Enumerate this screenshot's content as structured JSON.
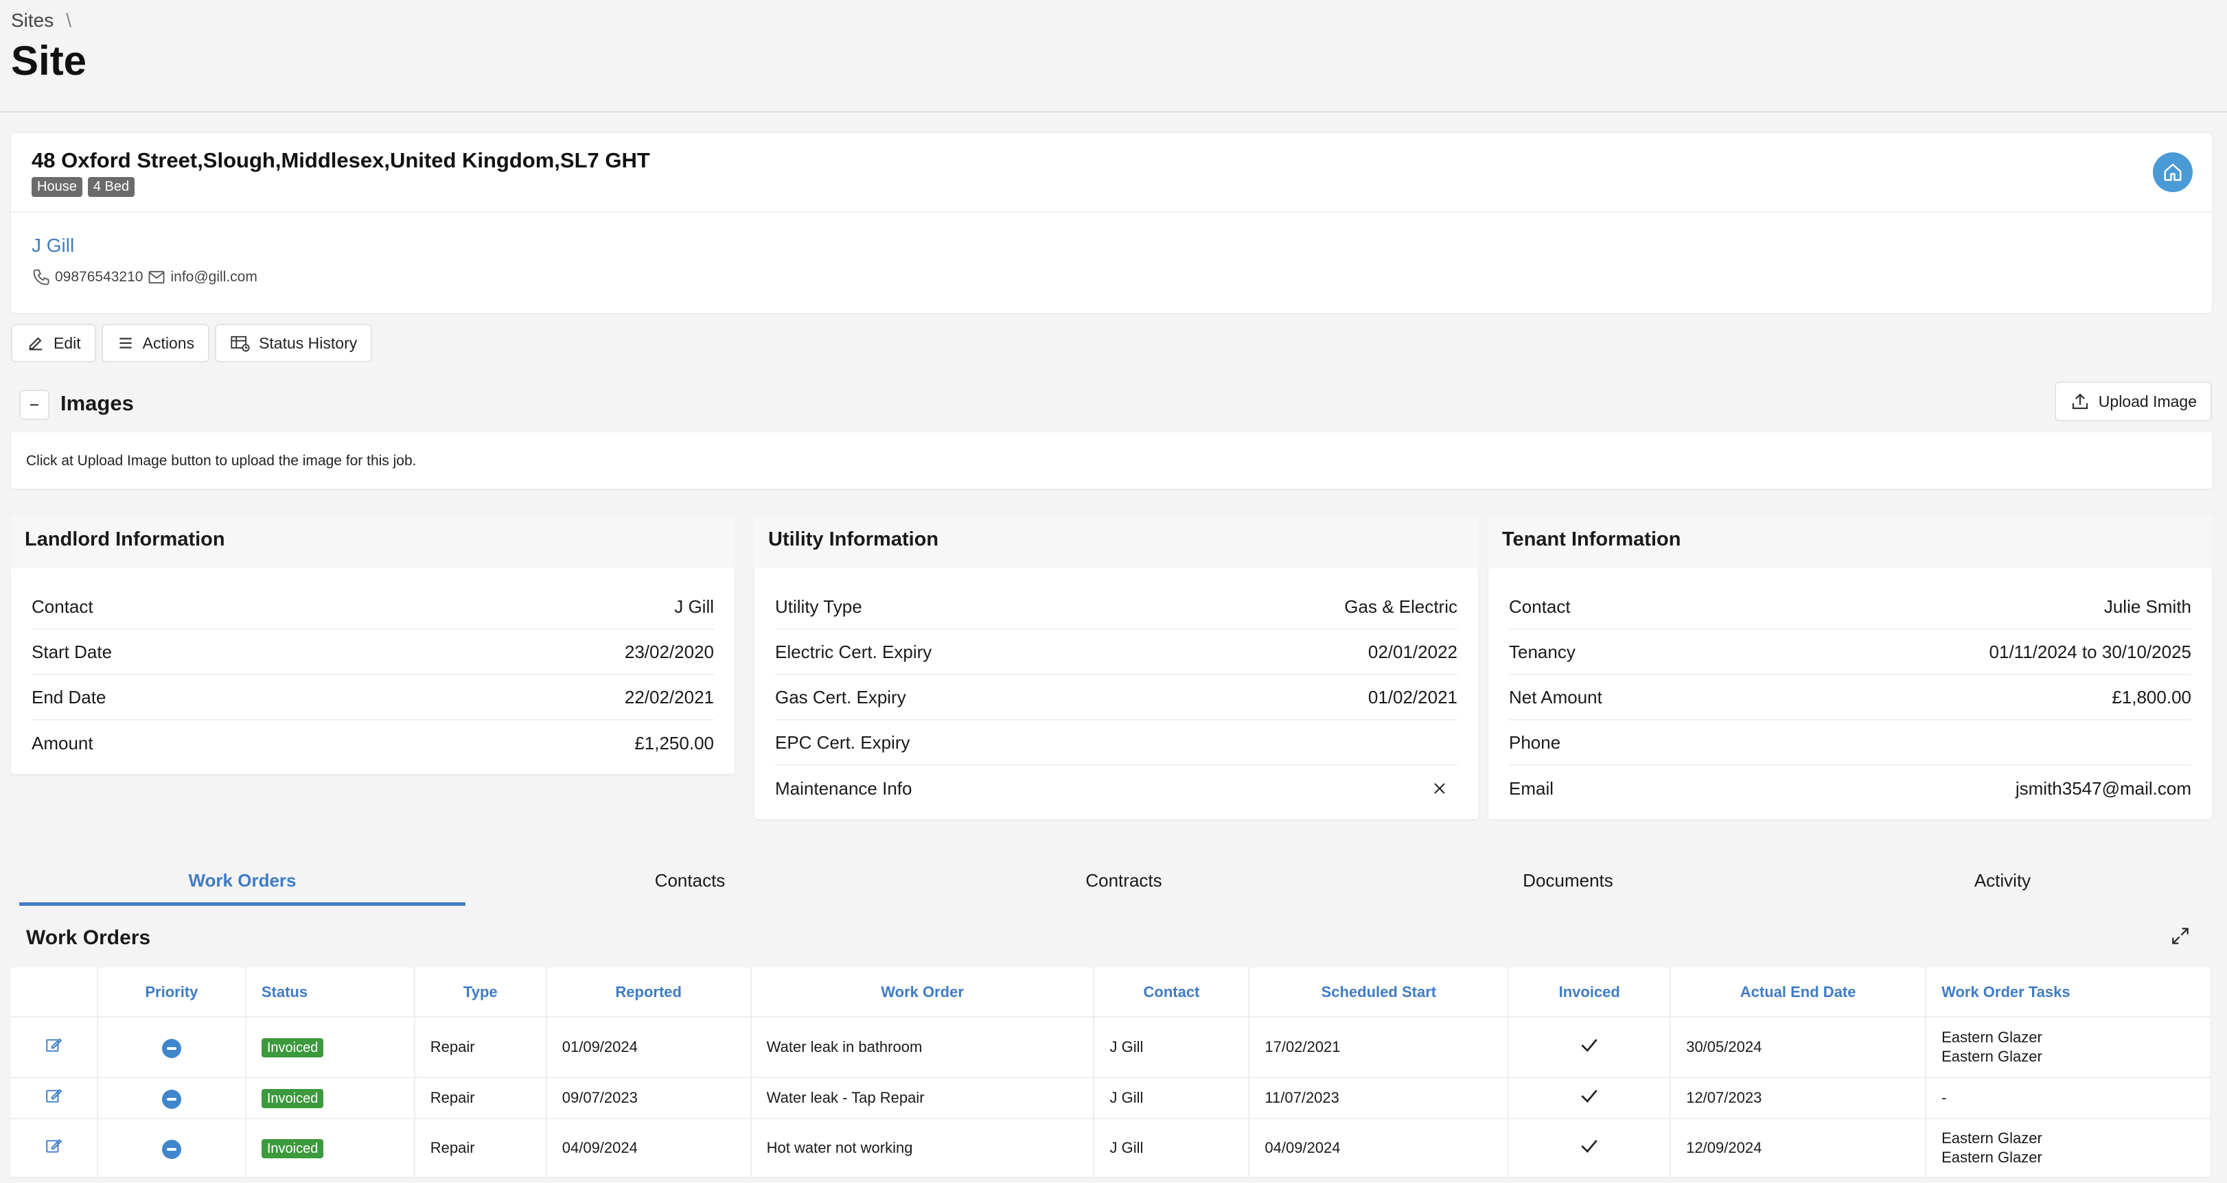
{
  "breadcrumb": {
    "root": "Sites",
    "separator": "\\"
  },
  "page_title": "Site",
  "site": {
    "address": "48 Oxford Street,Slough,Middlesex,United Kingdom,SL7 GHT",
    "badges": [
      "House",
      "4 Bed"
    ],
    "owner": "J Gill",
    "phone": "09876543210",
    "email": "info@gill.com"
  },
  "toolbar": {
    "edit": "Edit",
    "actions": "Actions",
    "status_history": "Status History"
  },
  "images": {
    "title": "Images",
    "upload_label": "Upload Image",
    "empty_message": "Click at Upload Image button to upload the image for this job."
  },
  "landlord": {
    "title": "Landlord Information",
    "rows": [
      {
        "label": "Contact",
        "value": "J Gill"
      },
      {
        "label": "Start Date",
        "value": "23/02/2020"
      },
      {
        "label": "End Date",
        "value": "22/02/2021"
      },
      {
        "label": "Amount",
        "value": "£1,250.00"
      }
    ]
  },
  "utility": {
    "title": "Utility Information",
    "rows": [
      {
        "label": "Utility Type",
        "value": "Gas & Electric"
      },
      {
        "label": "Electric Cert. Expiry",
        "value": "02/01/2022"
      },
      {
        "label": "Gas Cert. Expiry",
        "value": "01/02/2021"
      },
      {
        "label": "EPC Cert. Expiry",
        "value": ""
      },
      {
        "label": "Maintenance Info",
        "value": ""
      }
    ]
  },
  "tenant": {
    "title": "Tenant Information",
    "rows": [
      {
        "label": "Contact",
        "value": "Julie Smith"
      },
      {
        "label": "Tenancy",
        "value": "01/11/2024 to 30/10/2025"
      },
      {
        "label": "Net Amount",
        "value": "£1,800.00"
      },
      {
        "label": "Phone",
        "value": ""
      },
      {
        "label": "Email",
        "value": "jsmith3547@mail.com"
      }
    ]
  },
  "tabs": [
    "Work Orders",
    "Contacts",
    "Contracts",
    "Documents",
    "Activity"
  ],
  "work_orders": {
    "title": "Work Orders",
    "columns": [
      "Priority",
      "Status",
      "Type",
      "Reported",
      "Work Order",
      "Contact",
      "Scheduled Start",
      "Invoiced",
      "Actual End Date",
      "Work Order Tasks"
    ],
    "rows": [
      {
        "status": "Invoiced",
        "type": "Repair",
        "reported": "01/09/2024",
        "work_order": "Water leak in bathroom",
        "contact": "J Gill",
        "scheduled_start": "17/02/2021",
        "actual_end": "30/05/2024",
        "tasks": [
          "Eastern Glazer",
          "Eastern Glazer"
        ]
      },
      {
        "status": "Invoiced",
        "type": "Repair",
        "reported": "09/07/2023",
        "work_order": "Water leak - Tap Repair",
        "contact": "J Gill",
        "scheduled_start": "11/07/2023",
        "actual_end": "12/07/2023",
        "tasks": [
          "-"
        ]
      },
      {
        "status": "Invoiced",
        "type": "Repair",
        "reported": "04/09/2024",
        "work_order": "Hot water not working",
        "contact": "J Gill",
        "scheduled_start": "04/09/2024",
        "actual_end": "12/09/2024",
        "tasks": [
          "Eastern Glazer",
          "Eastern Glazer"
        ]
      }
    ]
  },
  "colors": {
    "accent": "#3f7cc4",
    "invoiced": "#3c9a3c",
    "home_button": "#4a9ad6"
  },
  "icons": [
    "home-icon",
    "phone-icon",
    "mail-icon",
    "edit-icon",
    "menu-icon",
    "status-history-icon",
    "minus-icon",
    "upload-icon",
    "close-icon",
    "expand-icon",
    "check-icon",
    "priority-icon"
  ]
}
